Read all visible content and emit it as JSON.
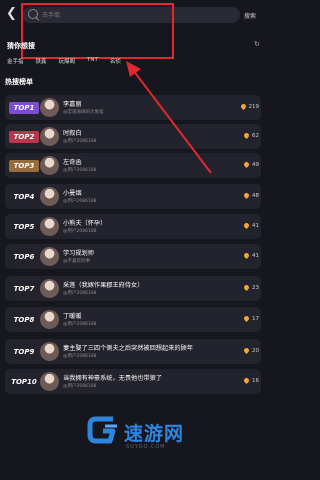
{
  "header": {
    "search_placeholder": "去手取",
    "search_button": "搜索"
  },
  "guess": {
    "title": "猜你想搜",
    "tags": [
      "金手指",
      "铁鑫",
      "玩爆阁",
      "TNT",
      "名侦"
    ]
  },
  "hot": {
    "title": "热搜榜单",
    "items": [
      {
        "rank": "TOP1",
        "title": "李嘉丽",
        "sub": "@宏观海阔的大象笔",
        "count": "219"
      },
      {
        "rank": "TOP2",
        "title": "时叙白",
        "sub": "@用户2086188",
        "count": "62"
      },
      {
        "rank": "TOP3",
        "title": "左奇函",
        "sub": "@用户2086188",
        "count": "49"
      },
      {
        "rank": "TOP4",
        "title": "小曼烟",
        "sub": "@用户2086188",
        "count": "48"
      },
      {
        "rank": "TOP5",
        "title": "小熊夫（怀孕）",
        "sub": "@用户2086188",
        "count": "41"
      },
      {
        "rank": "TOP6",
        "title": "学习规划师",
        "sub": "@不喜欢的事",
        "count": "41"
      },
      {
        "rank": "TOP7",
        "title": "采莲（我嫁作果郡王府侍女）",
        "sub": "@用户2086188",
        "count": "23"
      },
      {
        "rank": "TOP8",
        "title": "丁暖暖",
        "sub": "@用户2086188",
        "count": "17"
      },
      {
        "rank": "TOP9",
        "title": "妻主娶了三四个侧夫之后突然被回想起来的顾年",
        "sub": "@用户2086188",
        "count": "20"
      },
      {
        "rank": "TOP10",
        "title": "当我拥有神豪系统，无畏他也带狼了",
        "sub": "@用户2086188",
        "count": "16"
      }
    ]
  },
  "watermark": {
    "name": "速游网",
    "domain": "SUYOO.COM"
  }
}
